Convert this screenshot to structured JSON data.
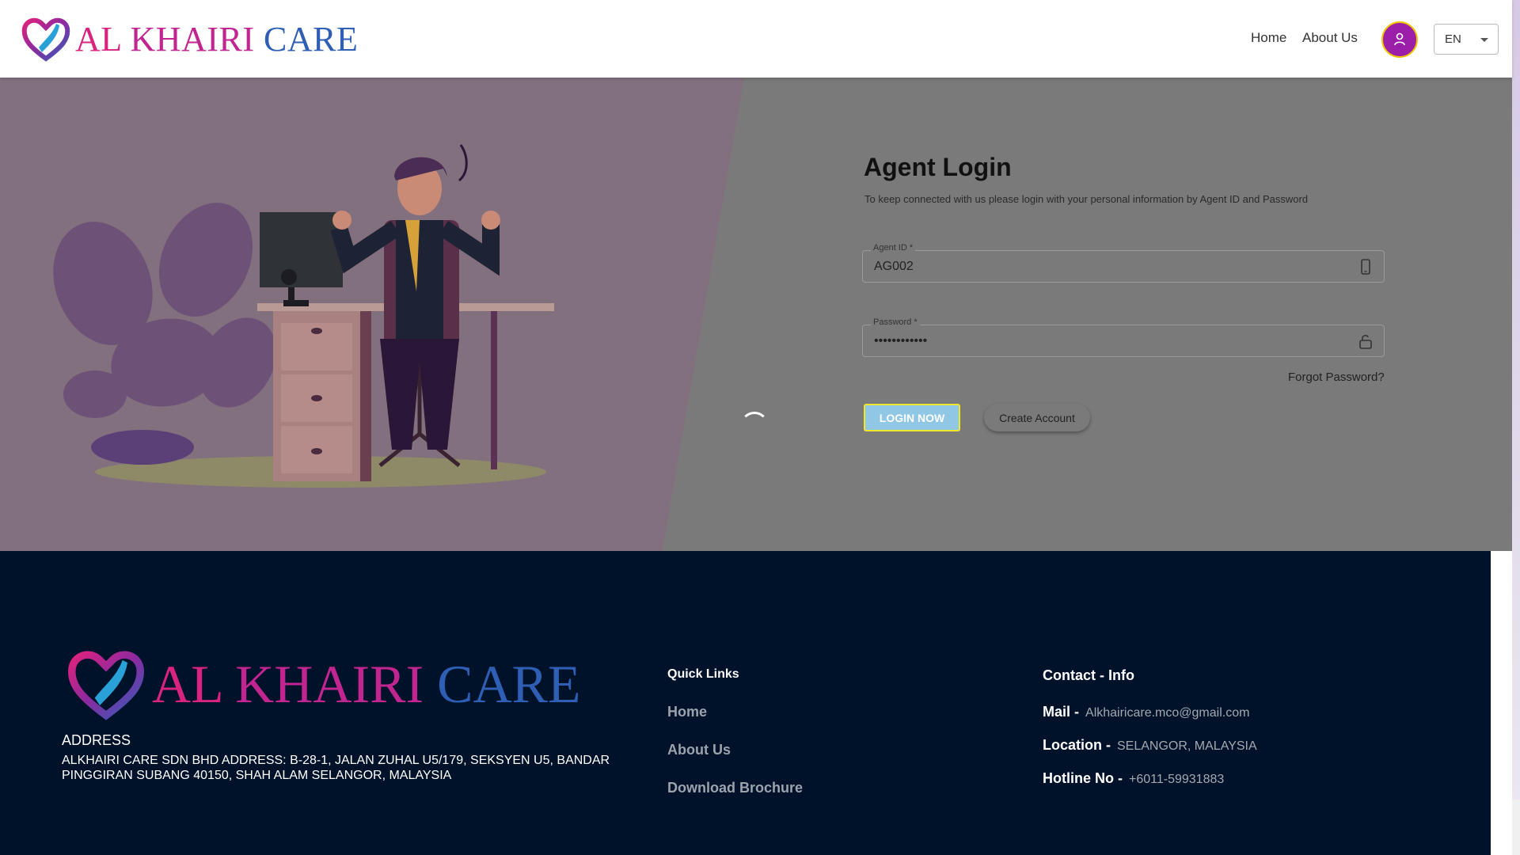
{
  "header": {
    "logo": {
      "word1": "AL",
      "word2": "KHAIRI",
      "word3": "CARE"
    },
    "nav": {
      "home": "Home",
      "about": "About Us"
    },
    "language": "EN"
  },
  "login": {
    "title": "Agent Login",
    "subtitle": "To keep connected with us please login with your personal information by Agent ID and Password",
    "agent_id": {
      "label": "Agent ID *",
      "value": "AG002"
    },
    "password": {
      "label": "Password *",
      "value": "••••••••••••"
    },
    "forgot": "Forgot Password?",
    "login_button": "LOGIN NOW",
    "create_button": "Create Account"
  },
  "footer": {
    "logo": {
      "word1": "AL",
      "word2": "KHAIRI",
      "word3": "CARE"
    },
    "address_title": "ADDRESS",
    "address": "ALKHAIRI CARE SDN BHD ADDRESS: B-28-1, JALAN ZUHAL U5/179, SEKSYEN U5, BANDAR PINGGIRAN SUBANG 40150, SHAH ALAM SELANGOR, MALAYSIA",
    "quick_links_title": "Quick Links",
    "quick_links": [
      "Home",
      "About Us",
      "Download Brochure"
    ],
    "contact_title": "Contact - Info",
    "contact": {
      "mail_label": "Mail -",
      "mail": "Alkhairicare.mco@gmail.com",
      "location_label": "Location -",
      "location": "SELANGOR, MALAYSIA",
      "hotline_label": "Hotline No -",
      "hotline": "+6011-59931883"
    }
  },
  "colors": {
    "brand_pink": "#d8247e",
    "brand_blue": "#2f5eb5",
    "avatar_purple": "#9b1fa8",
    "footer_bg": "#00112a",
    "login_button": "#8fc7e5"
  }
}
